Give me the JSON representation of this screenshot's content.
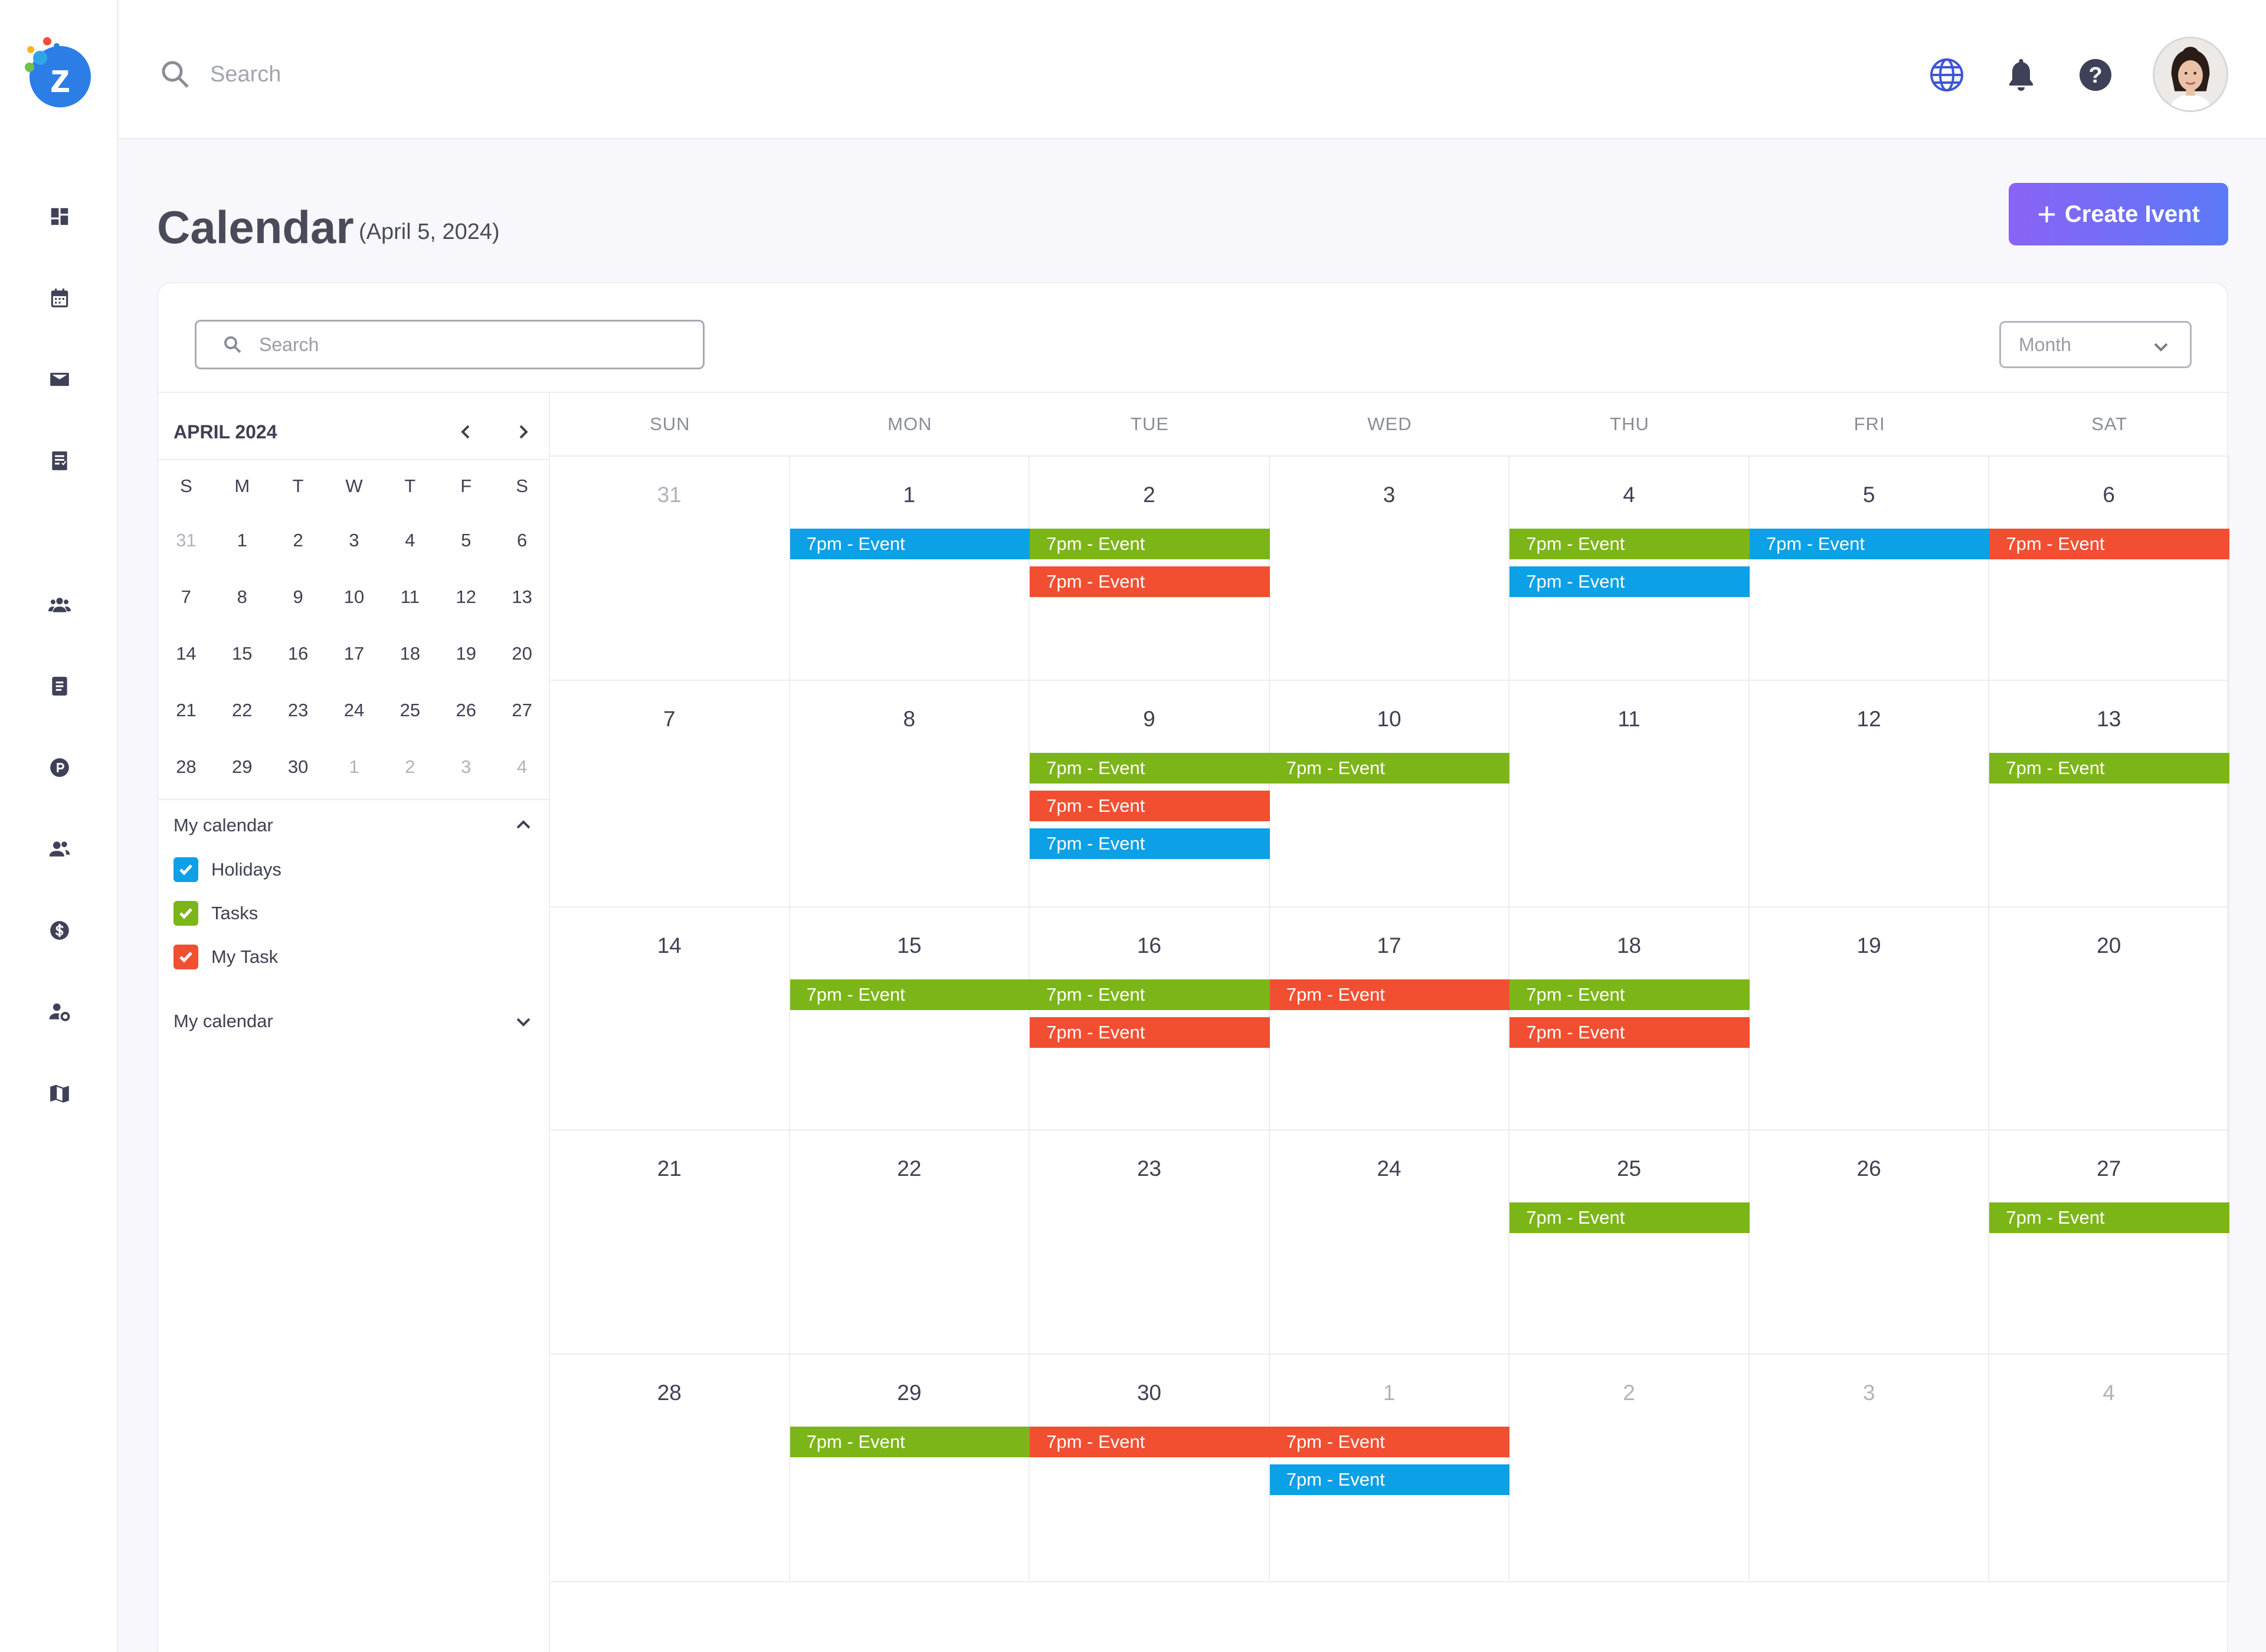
{
  "app": {
    "logo_letter": "z",
    "brand_colors": {
      "accent_blue": "#2c7ee6",
      "dot_red": "#f24e3a",
      "dot_yellow": "#f7b51c",
      "dot_green": "#6cc24a"
    }
  },
  "sidebar": {
    "items": [
      {
        "icon": "dashboard-icon"
      },
      {
        "icon": "calendar-icon"
      },
      {
        "icon": "mail-icon"
      },
      {
        "icon": "task-list-icon"
      },
      {
        "icon": "team-icon"
      },
      {
        "icon": "document-icon"
      },
      {
        "icon": "parking-icon"
      },
      {
        "icon": "users-icon"
      },
      {
        "icon": "dollar-icon"
      },
      {
        "icon": "user-settings-icon"
      },
      {
        "icon": "map-icon"
      }
    ]
  },
  "topbar": {
    "search_placeholder": "Search",
    "icons": [
      "globe-icon",
      "bell-icon",
      "help-icon"
    ],
    "accent_color": "#3d55d6"
  },
  "header": {
    "title": "Calendar",
    "date": "(April 5, 2024)",
    "create_button": "Create Ivent"
  },
  "toolbar": {
    "search_placeholder": "Search",
    "view_selected": "Month"
  },
  "mini_calendar": {
    "month_label": "APRIL 2024",
    "weekdays": [
      "S",
      "M",
      "T",
      "W",
      "T",
      "F",
      "S"
    ],
    "weeks": [
      [
        {
          "d": "31",
          "m": true
        },
        {
          "d": "1"
        },
        {
          "d": "2"
        },
        {
          "d": "3"
        },
        {
          "d": "4"
        },
        {
          "d": "5"
        },
        {
          "d": "6"
        }
      ],
      [
        {
          "d": "7"
        },
        {
          "d": "8"
        },
        {
          "d": "9"
        },
        {
          "d": "10"
        },
        {
          "d": "11"
        },
        {
          "d": "12"
        },
        {
          "d": "13"
        }
      ],
      [
        {
          "d": "14"
        },
        {
          "d": "15"
        },
        {
          "d": "16"
        },
        {
          "d": "17"
        },
        {
          "d": "18"
        },
        {
          "d": "19"
        },
        {
          "d": "20"
        }
      ],
      [
        {
          "d": "21"
        },
        {
          "d": "22"
        },
        {
          "d": "23"
        },
        {
          "d": "24"
        },
        {
          "d": "25"
        },
        {
          "d": "26"
        },
        {
          "d": "27"
        }
      ],
      [
        {
          "d": "28"
        },
        {
          "d": "29"
        },
        {
          "d": "30"
        },
        {
          "d": "1",
          "m": true
        },
        {
          "d": "2",
          "m": true
        },
        {
          "d": "3",
          "m": true
        },
        {
          "d": "4",
          "m": true
        }
      ]
    ]
  },
  "calendars": {
    "section1_label": "My calendar",
    "items": [
      {
        "label": "Holidays",
        "color": "#0ca0e6"
      },
      {
        "label": "Tasks",
        "color": "#7cb518"
      },
      {
        "label": "My Task",
        "color": "#f24e32"
      }
    ],
    "section2_label": "My calendar"
  },
  "month_view": {
    "weekdays": [
      "SUN",
      "MON",
      "TUE",
      "WED",
      "THU",
      "FRI",
      "SAT"
    ],
    "event_colors": {
      "blue": "#0ca0e6",
      "green": "#7cb518",
      "red": "#f24e32"
    },
    "weeks": [
      [
        {
          "d": "31",
          "m": true,
          "events": []
        },
        {
          "d": "1",
          "events": [
            {
              "t": "7pm - Event",
              "c": "blue"
            }
          ]
        },
        {
          "d": "2",
          "events": [
            {
              "t": "7pm - Event",
              "c": "green"
            },
            {
              "t": "7pm - Event",
              "c": "red"
            }
          ]
        },
        {
          "d": "3",
          "events": []
        },
        {
          "d": "4",
          "events": [
            {
              "t": "7pm - Event",
              "c": "green"
            },
            {
              "t": "7pm - Event",
              "c": "blue"
            }
          ]
        },
        {
          "d": "5",
          "events": [
            {
              "t": "7pm - Event",
              "c": "blue"
            }
          ]
        },
        {
          "d": "6",
          "events": [
            {
              "t": "7pm - Event",
              "c": "red"
            }
          ]
        }
      ],
      [
        {
          "d": "7",
          "events": []
        },
        {
          "d": "8",
          "events": []
        },
        {
          "d": "9",
          "events": [
            {
              "t": "7pm - Event",
              "c": "green"
            },
            {
              "t": "7pm - Event",
              "c": "red"
            },
            {
              "t": "7pm - Event",
              "c": "blue"
            }
          ]
        },
        {
          "d": "10",
          "events": [
            {
              "t": "7pm - Event",
              "c": "green"
            }
          ]
        },
        {
          "d": "11",
          "events": []
        },
        {
          "d": "12",
          "events": []
        },
        {
          "d": "13",
          "events": [
            {
              "t": "7pm - Event",
              "c": "green"
            }
          ]
        }
      ],
      [
        {
          "d": "14",
          "events": []
        },
        {
          "d": "15",
          "events": [
            {
              "t": "7pm - Event",
              "c": "green"
            }
          ]
        },
        {
          "d": "16",
          "events": [
            {
              "t": "7pm - Event",
              "c": "green"
            },
            {
              "t": "7pm - Event",
              "c": "red"
            }
          ]
        },
        {
          "d": "17",
          "events": [
            {
              "t": "7pm - Event",
              "c": "red"
            }
          ]
        },
        {
          "d": "18",
          "events": [
            {
              "t": "7pm - Event",
              "c": "green"
            },
            {
              "t": "7pm - Event",
              "c": "red"
            }
          ]
        },
        {
          "d": "19",
          "events": []
        },
        {
          "d": "20",
          "events": []
        }
      ],
      [
        {
          "d": "21",
          "events": []
        },
        {
          "d": "22",
          "events": []
        },
        {
          "d": "23",
          "events": []
        },
        {
          "d": "24",
          "events": []
        },
        {
          "d": "25",
          "events": [
            {
              "t": "7pm - Event",
              "c": "green"
            }
          ]
        },
        {
          "d": "26",
          "events": []
        },
        {
          "d": "27",
          "events": [
            {
              "t": "7pm - Event",
              "c": "green"
            }
          ]
        }
      ],
      [
        {
          "d": "28",
          "events": []
        },
        {
          "d": "29",
          "events": [
            {
              "t": "7pm - Event",
              "c": "green"
            }
          ]
        },
        {
          "d": "30",
          "events": [
            {
              "t": "7pm - Event",
              "c": "red"
            }
          ]
        },
        {
          "d": "1",
          "m": true,
          "events": [
            {
              "t": "7pm - Event",
              "c": "red"
            },
            {
              "t": "7pm - Event",
              "c": "blue"
            }
          ]
        },
        {
          "d": "2",
          "m": true,
          "events": []
        },
        {
          "d": "3",
          "m": true,
          "events": []
        },
        {
          "d": "4",
          "m": true,
          "events": []
        }
      ]
    ]
  }
}
